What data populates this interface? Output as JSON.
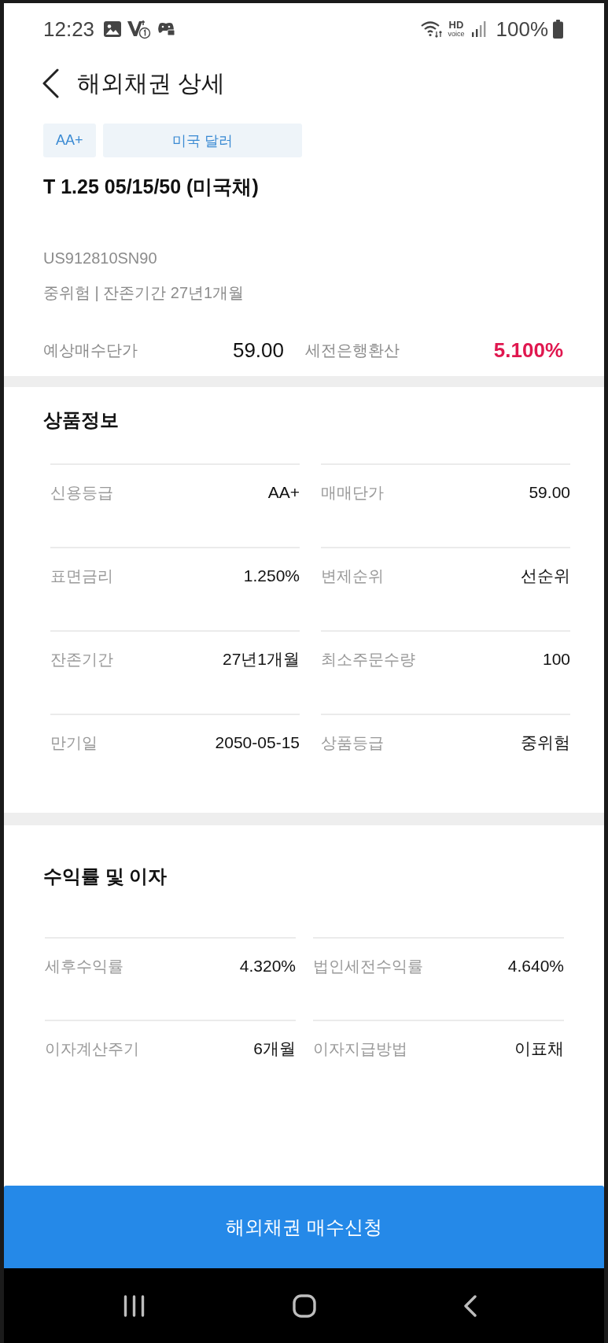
{
  "status_bar": {
    "time": "12:23",
    "hd_label": "HD",
    "voice_label": "voice",
    "battery": "100%"
  },
  "header": {
    "title": "해외채권 상세"
  },
  "tags": [
    {
      "label": "AA+",
      "kind": "rating"
    },
    {
      "label": "미국 달러",
      "kind": "currency"
    }
  ],
  "bond": {
    "name": "T 1.25 05/15/50 (미국채)",
    "code": "US912810SN90",
    "summary": "중위험 | 잔존기간 27년1개월"
  },
  "quote": [
    {
      "label": "예상매수단가",
      "value": "59.00",
      "highlighted": false
    },
    {
      "label": "세전은행환산",
      "value": "5.100%",
      "highlighted": true
    }
  ],
  "sections": [
    {
      "title": "상품정보",
      "items": [
        {
          "label": "신용등급",
          "value": "AA+"
        },
        {
          "label": "매매단가",
          "value": "59.00"
        },
        {
          "label": "표면금리",
          "value": "1.250%"
        },
        {
          "label": "변제순위",
          "value": "선순위"
        },
        {
          "label": "잔존기간",
          "value": "27년1개월"
        },
        {
          "label": "최소주문수량",
          "value": "100"
        },
        {
          "label": "만기일",
          "value": "2050-05-15"
        },
        {
          "label": "상품등급",
          "value": "중위험"
        }
      ]
    },
    {
      "title": "수익률 및 이자",
      "items": [
        {
          "label": "세후수익률",
          "value": "4.320%"
        },
        {
          "label": "법인세전수익률",
          "value": "4.640%"
        },
        {
          "label": "이자계산주기",
          "value": "6개월"
        },
        {
          "label": "이자지급방법",
          "value": "이표채"
        }
      ]
    }
  ],
  "action_button": {
    "label": "해외채권 매수신청"
  }
}
